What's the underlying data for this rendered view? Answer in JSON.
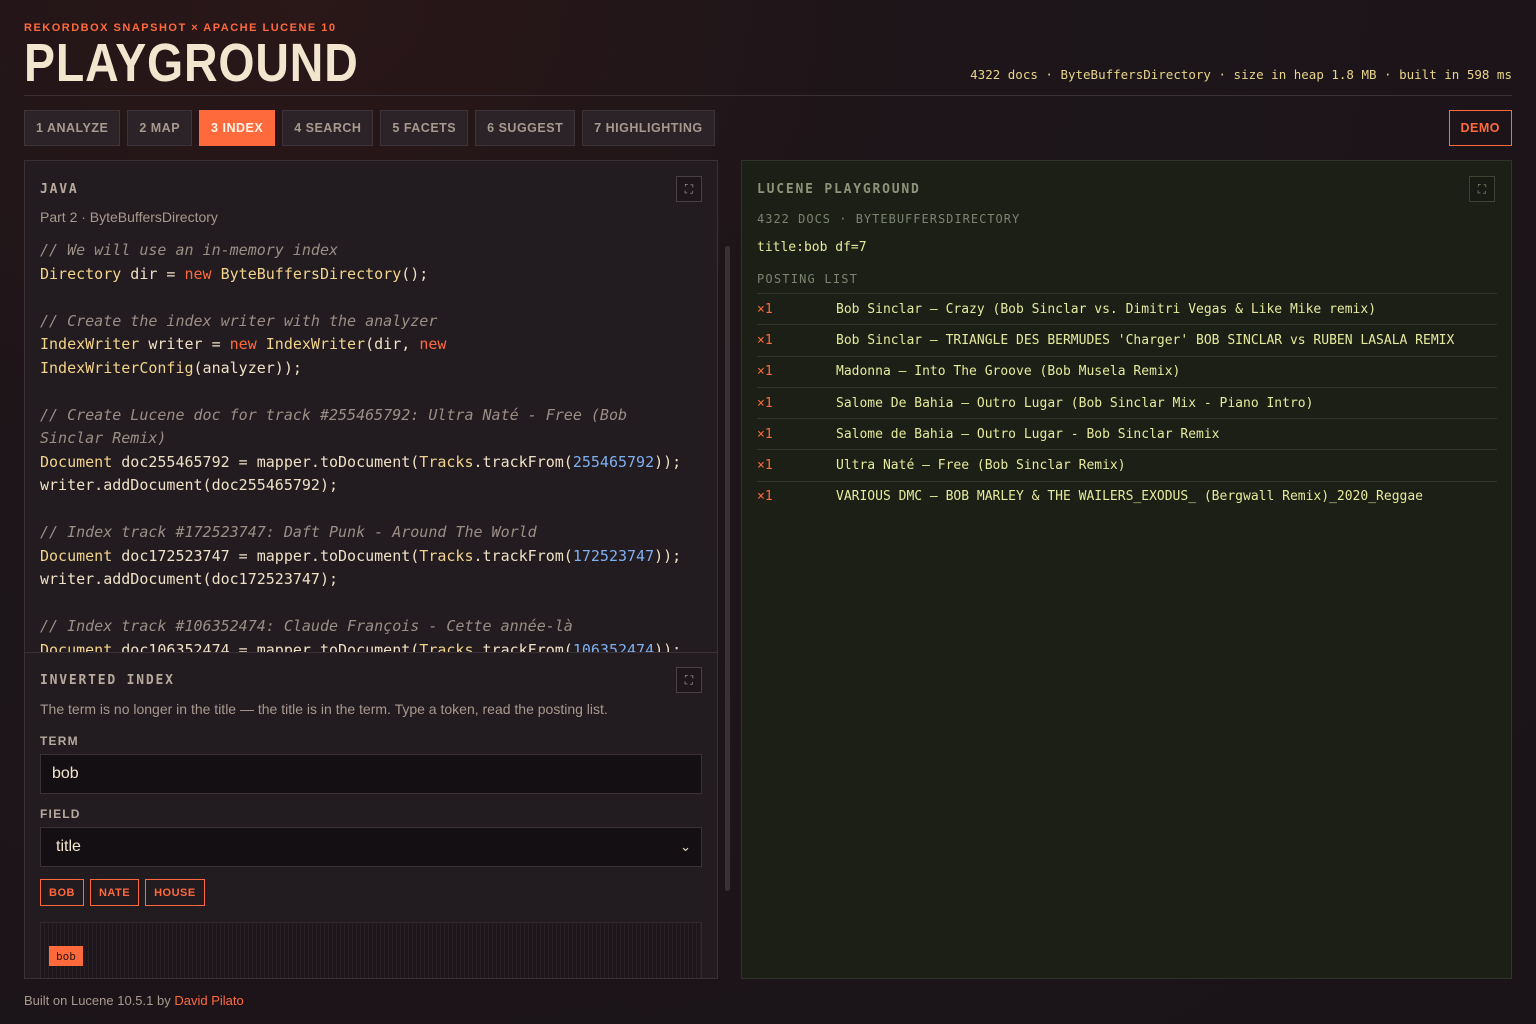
{
  "header": {
    "kicker": "REKORDBOX SNAPSHOT × APACHE LUCENE 10",
    "title": "PLAYGROUND",
    "stats": "4322 docs · ByteBuffersDirectory · size in heap 1.8 MB · built in 598 ms"
  },
  "tabs": [
    {
      "label": "1 ANALYZE"
    },
    {
      "label": "2 MAP"
    },
    {
      "label": "3 INDEX",
      "active": true
    },
    {
      "label": "4 SEARCH"
    },
    {
      "label": "5 FACETS"
    },
    {
      "label": "6 SUGGEST"
    },
    {
      "label": "7 HIGHLIGHTING"
    }
  ],
  "demo_label": "DEMO",
  "java": {
    "title": "JAVA",
    "subtitle": "Part 2 · ByteBuffersDirectory"
  },
  "inverted": {
    "title": "INVERTED INDEX",
    "description": "The term is no longer in the title — the title is in the term. Type a token, read the posting list.",
    "term_label": "TERM",
    "term_value": "bob",
    "field_label": "FIELD",
    "field_value": "title",
    "chips": [
      "BOB",
      "NATE",
      "HOUSE"
    ],
    "highlight": "bob"
  },
  "playground": {
    "title": "LUCENE PLAYGROUND",
    "subtitle": "4322 DOCS · BYTEBUFFERSDIRECTORY",
    "query": "title:bob df=7",
    "posting_label": "POSTING LIST",
    "postings": [
      {
        "count": "×1",
        "title": "Bob Sinclar — Crazy (Bob Sinclar vs. Dimitri Vegas & Like Mike remix)"
      },
      {
        "count": "×1",
        "title": "Bob Sinclar — TRIANGLE DES BERMUDES 'Charger' BOB SINCLAR vs RUBEN LASALA REMIX"
      },
      {
        "count": "×1",
        "title": "Madonna — Into The Groove (Bob Musela Remix)"
      },
      {
        "count": "×1",
        "title": "Salome De Bahia — Outro Lugar (Bob Sinclar Mix - Piano Intro)"
      },
      {
        "count": "×1",
        "title": "Salome de Bahia — Outro Lugar - Bob Sinclar Remix"
      },
      {
        "count": "×1",
        "title": "Ultra Naté — Free (Bob Sinclar Remix)"
      },
      {
        "count": "×1",
        "title": "VARIOUS DMC — BOB MARLEY & THE WAILERS_EXODUS_ (Bergwall Remix)_2020_Reggae"
      }
    ]
  },
  "footer": {
    "text": "Built on Lucene 10.5.1 by ",
    "author": "David Pilato"
  },
  "icons": {
    "expand": "expand-icon",
    "dropdown": "chevron-down-icon"
  }
}
